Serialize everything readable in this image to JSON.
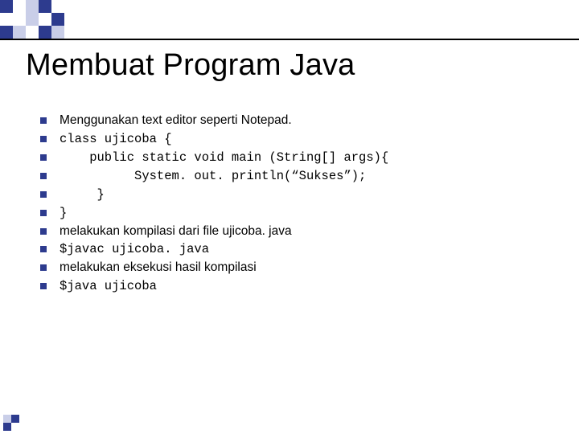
{
  "title": "Membuat Program Java",
  "bullets": [
    {
      "text": "Menggunakan text editor seperti Notepad.",
      "font": "sans"
    },
    {
      "text": "class ujicoba {",
      "font": "mono"
    },
    {
      "text": "    public static void main (String[] args){",
      "font": "mono"
    },
    {
      "text": "          System. out. println(“Sukses”);",
      "font": "mono"
    },
    {
      "text": "     }",
      "font": "mono"
    },
    {
      "text": "}",
      "font": "mono"
    },
    {
      "text": "melakukan kompilasi dari file ujicoba. java",
      "font": "sans"
    },
    {
      "text": "$javac ujicoba. java",
      "font": "mono"
    },
    {
      "text": "melakukan eksekusi hasil kompilasi",
      "font": "sans"
    },
    {
      "text": "$java ujicoba",
      "font": "mono"
    }
  ],
  "colors": {
    "accent": "#2d3b8e",
    "accent_light": "#c9cee8"
  }
}
